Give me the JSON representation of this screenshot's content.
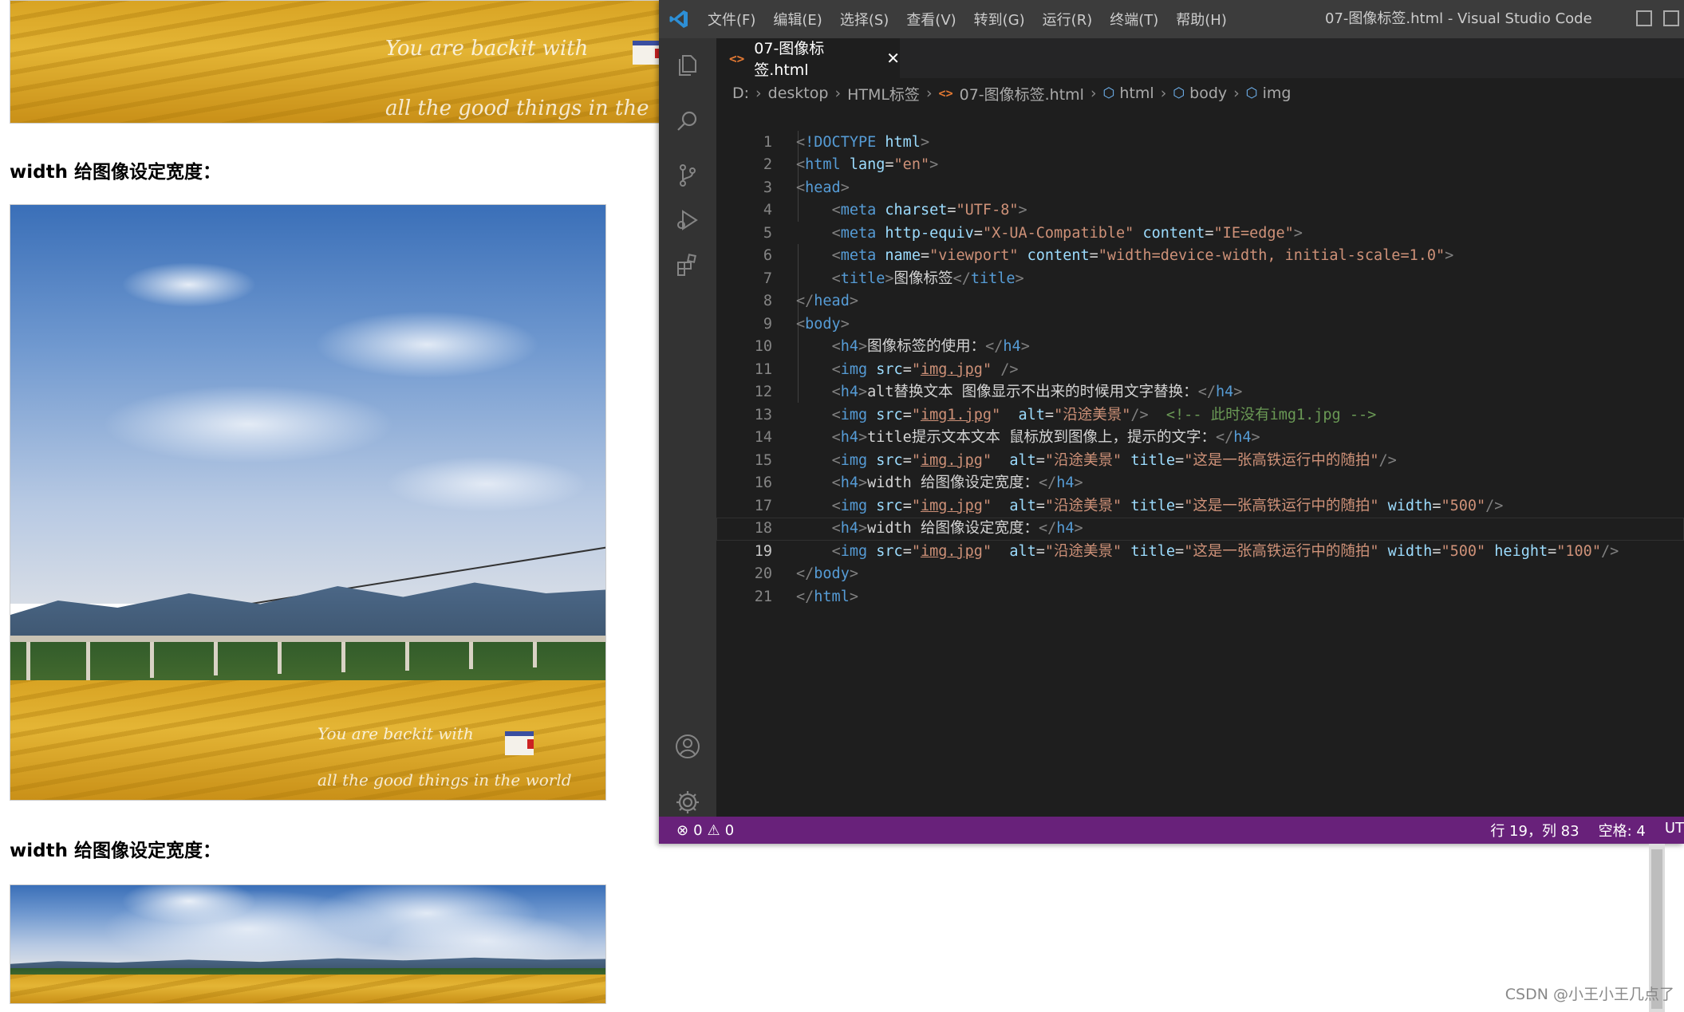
{
  "page": {
    "headings": [
      "width 给图像设定宽度：",
      "width 给图像设定宽度："
    ],
    "photo_caption_line1": "You are backit with",
    "photo_caption_line2": "all the good things in the world"
  },
  "vscode": {
    "menu": [
      "文件(F)",
      "编辑(E)",
      "选择(S)",
      "查看(V)",
      "转到(G)",
      "运行(R)",
      "终端(T)",
      "帮助(H)"
    ],
    "window_title": "07-图像标签.html - Visual Studio Code",
    "tab": {
      "label": "07-图像标签.html",
      "close": "✕"
    },
    "breadcrumb": [
      "D:",
      "desktop",
      "HTML标签",
      "07-图像标签.html",
      "html",
      "body",
      "img"
    ],
    "code": {
      "line_numbers": [
        "1",
        "2",
        "3",
        "4",
        "5",
        "6",
        "7",
        "8",
        "9",
        "10",
        "11",
        "12",
        "13",
        "14",
        "15",
        "16",
        "17",
        "18",
        "19",
        "20",
        "21"
      ],
      "text": {
        "doctype": "!DOCTYPE",
        "html": "html",
        "lang": "lang",
        "en": "\"en\"",
        "head": "head",
        "meta": "meta",
        "charset": "charset",
        "utf8": "\"UTF-8\"",
        "http_equiv": "http-equiv",
        "xua": "\"X-UA-Compatible\"",
        "content": "content",
        "ie_edge": "\"IE=edge\"",
        "name": "name",
        "viewport": "\"viewport\"",
        "viewport_content": "\"width=device-width, initial-scale=1.0\"",
        "title": "title",
        "title_text": "图像标签",
        "body": "body",
        "h4": "h4",
        "img": "img",
        "src": "src",
        "alt": "alt",
        "width": "width",
        "height": "height",
        "q": "\"",
        "img_jpg": "img.jpg",
        "img1_jpg": "img1.jpg",
        "alt_val": "\"沿途美景\"",
        "title_val": "\"这是一张高铁运行中的随拍\"",
        "w500": "\"500\"",
        "h100": "\"100\"",
        "h4_1": "图像标签的使用：",
        "h4_2": "alt替换文本 图像显示不出来的时候用文字替换：",
        "comment": "<!-- 此时没有img1.jpg -->",
        "h4_3": "title提示文本文本 鼠标放到图像上，提示的文字：",
        "h4_4": "width 给图像设定宽度：",
        "h4_5": "width 给图像设定宽度："
      }
    },
    "status": {
      "errors": "0",
      "warnings": "0",
      "position": "行 19，列 83",
      "spaces": "空格: 4",
      "encoding": "UT"
    }
  },
  "watermark": "CSDN @小王小王几点了"
}
